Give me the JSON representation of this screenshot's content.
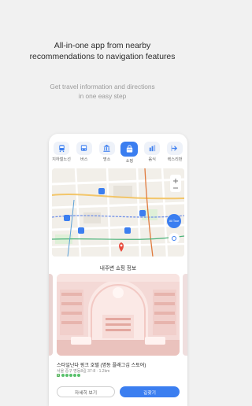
{
  "headline": {
    "line1": "All-in-one app from nearby",
    "line2": "recommendations to navigation features"
  },
  "subline": {
    "line1": "Get travel information and directions",
    "line2": "in one easy step"
  },
  "tabs": [
    {
      "label": "지하철노선",
      "icon": "subway-icon"
    },
    {
      "label": "버스",
      "icon": "bus-icon"
    },
    {
      "label": "명소",
      "icon": "landmark-icon"
    },
    {
      "label": "쇼핑",
      "icon": "shopping-icon",
      "active": true
    },
    {
      "label": "음식",
      "icon": "food-icon"
    },
    {
      "label": "렉스리펀",
      "icon": "tax-refund-icon"
    }
  ],
  "map": {
    "button_label": "All Tour"
  },
  "section": {
    "title": "내주변 쇼핑 정보"
  },
  "store": {
    "name": "스타일난다 핑크 호텔 (명동 플래그십 스토어)",
    "address": "서울 중구 명동8길 37-8",
    "distance": "1.2km",
    "rating_badge": "5"
  },
  "buttons": {
    "detail": "자세히 보기",
    "route": "길찾기"
  },
  "colors": {
    "accent": "#3b7ef0",
    "background": "#f1f1f1",
    "rating": "#57c06a"
  }
}
